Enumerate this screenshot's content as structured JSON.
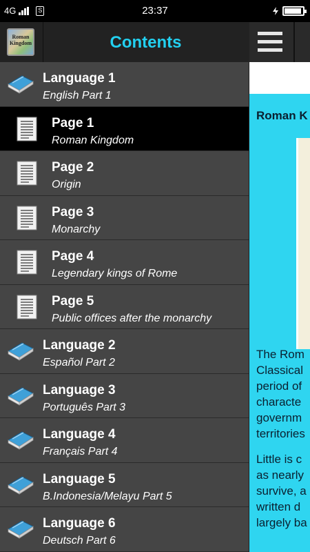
{
  "status_bar": {
    "network": "4G",
    "sim_label": "S",
    "time": "23:37"
  },
  "drawer": {
    "logo_text": "Roman Kingdom",
    "title": "Contents",
    "items": [
      {
        "kind": "language",
        "title": "Language 1",
        "subtitle": "English Part 1",
        "icon": "book-icon",
        "selected": false
      },
      {
        "kind": "page",
        "title": "Page 1",
        "subtitle": "Roman Kingdom",
        "icon": "document-icon",
        "selected": true
      },
      {
        "kind": "page",
        "title": "Page 2",
        "subtitle": "Origin",
        "icon": "document-icon",
        "selected": false
      },
      {
        "kind": "page",
        "title": "Page 3",
        "subtitle": "Monarchy",
        "icon": "document-icon",
        "selected": false
      },
      {
        "kind": "page",
        "title": "Page 4",
        "subtitle": "Legendary kings of Rome",
        "icon": "document-icon",
        "selected": false
      },
      {
        "kind": "page",
        "title": "Page 5",
        "subtitle": "Public offices after the monarchy",
        "icon": "document-icon",
        "selected": false
      },
      {
        "kind": "language",
        "title": "Language 2",
        "subtitle": "Español Part 2",
        "icon": "book-icon",
        "selected": false
      },
      {
        "kind": "language",
        "title": "Language 3",
        "subtitle": "Português Part 3",
        "icon": "book-icon",
        "selected": false
      },
      {
        "kind": "language",
        "title": "Language 4",
        "subtitle": "Français Part 4",
        "icon": "book-icon",
        "selected": false
      },
      {
        "kind": "language",
        "title": "Language 5",
        "subtitle": "B.Indonesia/Melayu Part 5",
        "icon": "book-icon",
        "selected": false
      },
      {
        "kind": "language",
        "title": "Language 6",
        "subtitle": "Deutsch Part 6",
        "icon": "book-icon",
        "selected": false
      }
    ]
  },
  "content": {
    "heading": "Roman K",
    "paragraph1": [
      "The Rom",
      "Classical",
      "period of",
      "characte",
      "governm",
      "territories"
    ],
    "paragraph2": [
      "Little is c",
      "as nearly",
      "survive, a",
      "written d",
      "largely ba"
    ]
  },
  "colors": {
    "accent": "#22d0f0",
    "content_bg": "#2fd5f0",
    "drawer_bg": "#454545",
    "selected_bg": "#000000"
  }
}
